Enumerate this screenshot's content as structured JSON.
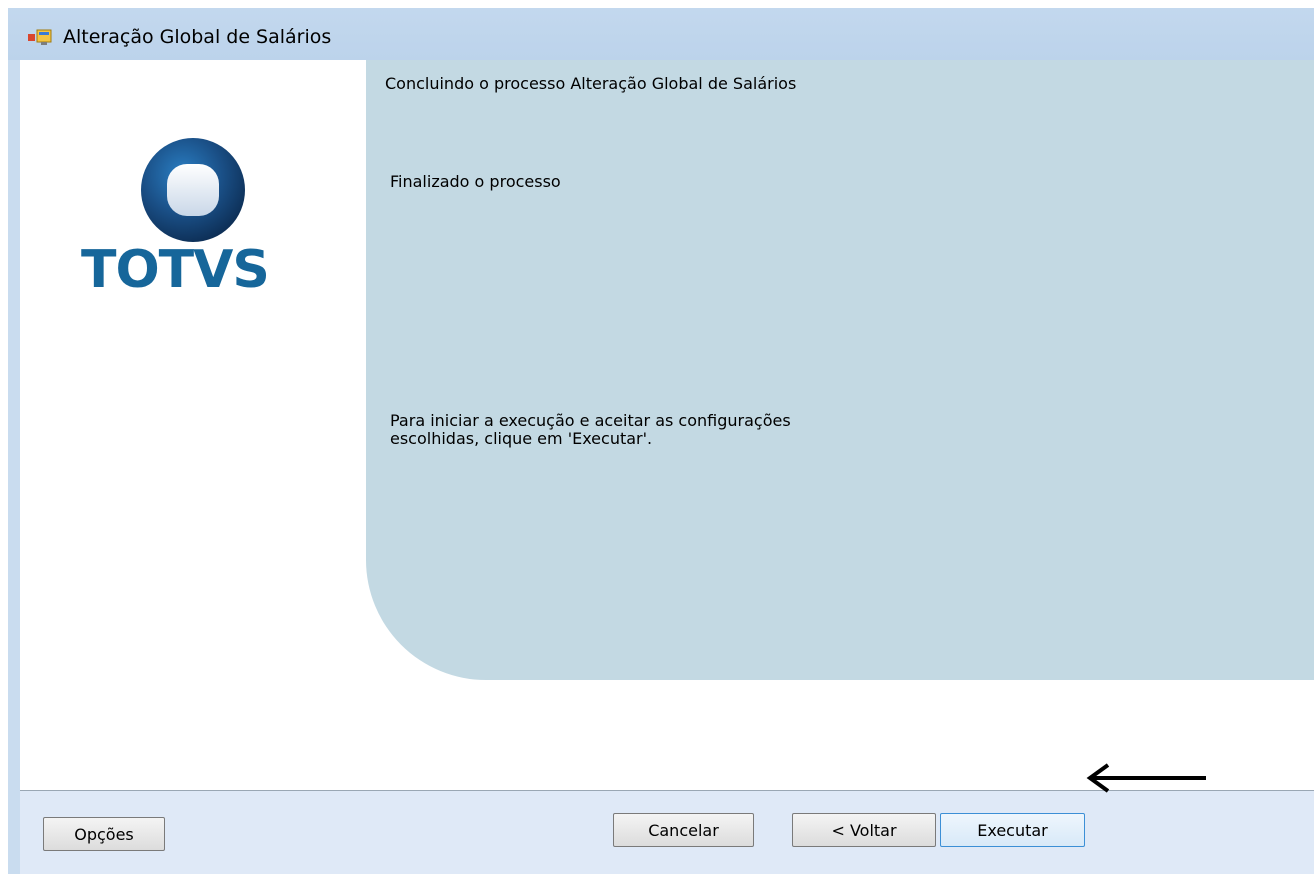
{
  "window": {
    "title": "Alteração Global de Salários"
  },
  "logo": {
    "wordmark": "TOTVS",
    "colors": {
      "blue": "#16669a",
      "dark": "#0d3b62"
    }
  },
  "panel": {
    "heading": "Concluindo o processo Alteração Global de Salários",
    "status": "Finalizado o processo",
    "instruction_lines": [
      "Para iniciar a execução e aceitar as configurações",
      "escolhidas, clique em 'Executar'."
    ],
    "background": "#c3d9e3"
  },
  "footer": {
    "options_label": "Opções",
    "cancel_label": "Cancelar",
    "back_label": "< Voltar",
    "execute_label": "Executar"
  },
  "annotation": {
    "icon": "arrow-left-icon"
  }
}
